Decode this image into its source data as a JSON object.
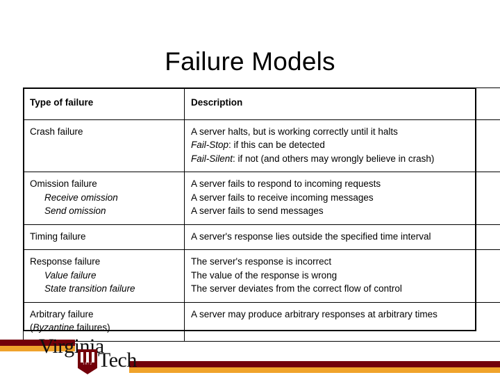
{
  "slide": {
    "title": "Failure Models"
  },
  "table": {
    "headers": {
      "type": "Type of failure",
      "description": "Description"
    },
    "rows": [
      {
        "type_main": "Crash failure",
        "type_subs": [],
        "desc_lines": [
          {
            "text": "A server halts, but is working correctly until it halts",
            "italic_prefix": ""
          },
          {
            "text": ": if this can be detected",
            "italic_prefix": "Fail-Stop"
          },
          {
            "text": ": if not (and others may wrongly believe in crash)",
            "italic_prefix": "Fail-Silent"
          }
        ]
      },
      {
        "type_main": "Omission failure",
        "type_subs": [
          "Receive omission",
          "Send omission"
        ],
        "desc_lines": [
          {
            "text": "A server fails to respond to incoming requests",
            "italic_prefix": ""
          },
          {
            "text": "A server fails to receive incoming messages",
            "italic_prefix": ""
          },
          {
            "text": "A server fails to send messages",
            "italic_prefix": ""
          }
        ]
      },
      {
        "type_main": "Timing failure",
        "type_subs": [],
        "desc_lines": [
          {
            "text": "A server's response lies outside the specified time interval",
            "italic_prefix": ""
          }
        ]
      },
      {
        "type_main": "Response failure",
        "type_subs": [
          "Value failure",
          "State transition failure"
        ],
        "desc_lines": [
          {
            "text": "The server's response is incorrect",
            "italic_prefix": ""
          },
          {
            "text": "The value of the response is wrong",
            "italic_prefix": ""
          },
          {
            "text": "The server deviates from the correct flow of control",
            "italic_prefix": ""
          }
        ]
      },
      {
        "type_main": "Arbitrary failure",
        "type_subs": [],
        "type_second_line": {
          "pre": "(",
          "italic": "Byzantine",
          "post": " failures)"
        },
        "desc_lines": [
          {
            "text": "A server may produce arbitrary responses at arbitrary times",
            "italic_prefix": ""
          }
        ]
      }
    ]
  },
  "footer": {
    "logo": {
      "line1": "Virginia",
      "line2": "Tech",
      "shield_year": "1872"
    },
    "colors": {
      "maroon": "#73000a",
      "orange": "#f0a32b"
    }
  }
}
